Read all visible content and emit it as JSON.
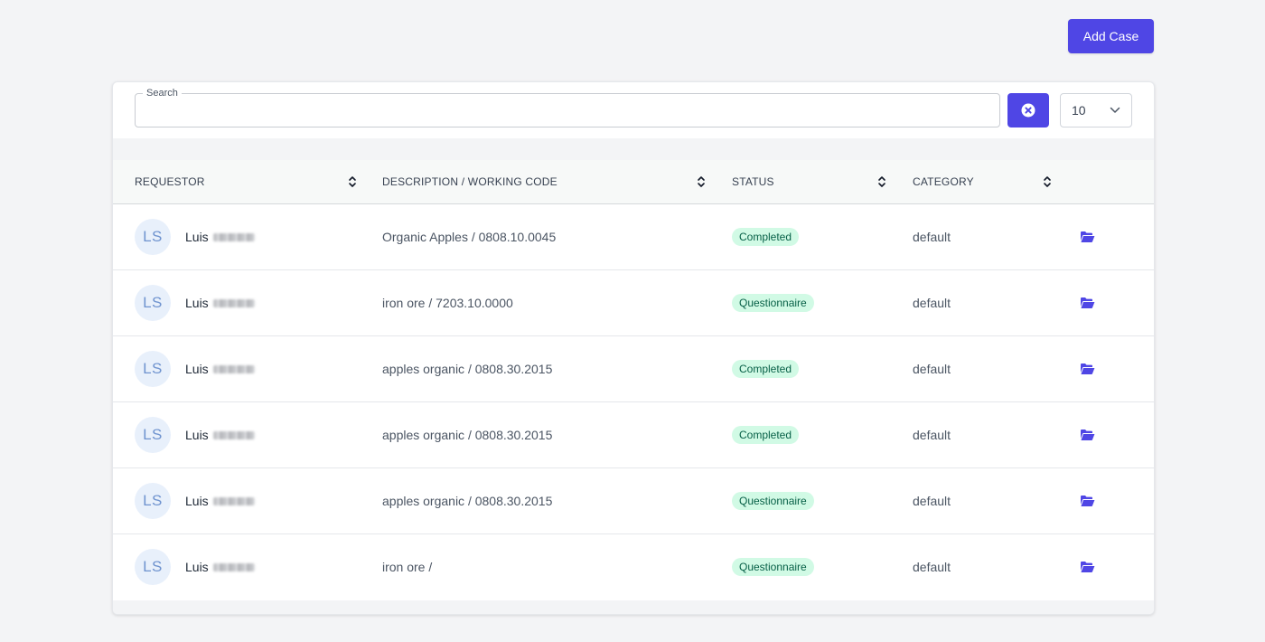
{
  "header": {
    "add_button_label": "Add Case"
  },
  "search": {
    "label": "Search",
    "value": "",
    "placeholder": ""
  },
  "pagination": {
    "page_size": "10"
  },
  "table": {
    "columns": [
      {
        "label": "REQUESTOR"
      },
      {
        "label": "DESCRIPTION / WORKING CODE"
      },
      {
        "label": "STATUS"
      },
      {
        "label": "CATEGORY"
      }
    ],
    "rows": [
      {
        "initials": "LS",
        "first_name": "Luis",
        "description": "Organic Apples / 0808.10.0045",
        "status": "Completed",
        "category": "default"
      },
      {
        "initials": "LS",
        "first_name": "Luis",
        "description": "iron ore / 7203.10.0000",
        "status": "Questionnaire",
        "category": "default"
      },
      {
        "initials": "LS",
        "first_name": "Luis",
        "description": "apples organic / 0808.30.2015",
        "status": "Completed",
        "category": "default"
      },
      {
        "initials": "LS",
        "first_name": "Luis",
        "description": "apples organic / 0808.30.2015",
        "status": "Completed",
        "category": "default"
      },
      {
        "initials": "LS",
        "first_name": "Luis",
        "description": "apples organic / 0808.30.2015",
        "status": "Questionnaire",
        "category": "default"
      },
      {
        "initials": "LS",
        "first_name": "Luis",
        "description": "iron ore /",
        "status": "Questionnaire",
        "category": "default"
      }
    ]
  },
  "icons": {
    "clear": "close-circle-icon",
    "dropdown": "chevron-down-icon",
    "sort": "sort-icon",
    "open": "folder-open-icon"
  },
  "colors": {
    "primary": "#4f46e5",
    "badge_bg": "#d1fae5",
    "badge_text": "#065f46",
    "avatar_bg": "#e8f0fb",
    "avatar_text": "#6f93cf"
  }
}
